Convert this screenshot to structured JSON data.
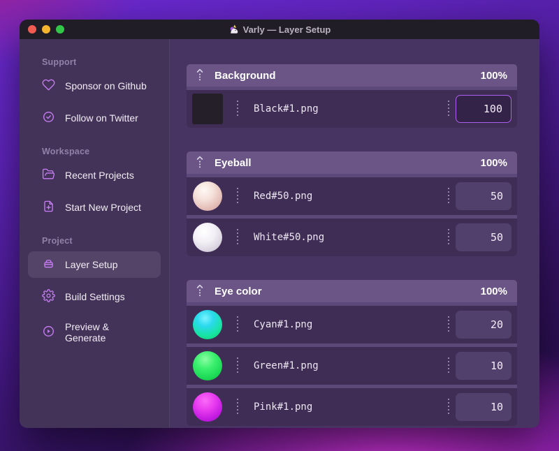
{
  "titlebar": {
    "title": "Varly — Layer Setup",
    "icon": "unicorn-icon",
    "traffic_lights": [
      {
        "name": "close-button",
        "color": "#f15b51"
      },
      {
        "name": "minimize-button",
        "color": "#f3b52e"
      },
      {
        "name": "zoom-button",
        "color": "#32c748"
      }
    ]
  },
  "sidebar": {
    "sections": [
      {
        "label": "Support",
        "items": [
          {
            "label": "Sponsor on Github",
            "icon": "heart-icon",
            "selected": false
          },
          {
            "label": "Follow on Twitter",
            "icon": "badge-check-icon",
            "selected": false
          }
        ]
      },
      {
        "label": "Workspace",
        "items": [
          {
            "label": "Recent Projects",
            "icon": "folder-open-icon",
            "selected": false
          },
          {
            "label": "Start New Project",
            "icon": "file-plus-icon",
            "selected": false
          }
        ]
      },
      {
        "label": "Project",
        "items": [
          {
            "label": "Layer Setup",
            "icon": "layer-box-icon",
            "selected": true
          },
          {
            "label": "Build Settings",
            "icon": "gear-icon",
            "selected": false
          },
          {
            "label": "Preview & Generate",
            "icon": "play-circle-icon",
            "selected": false
          }
        ]
      }
    ]
  },
  "main": {
    "groups": [
      {
        "name": "Background",
        "weight_label": "100%",
        "drag_icon": "drag-handle-icon",
        "rows": [
          {
            "file": "Black#1.png",
            "value": "100",
            "thumb": "black-square-thumb",
            "focused": true
          }
        ]
      },
      {
        "name": "Eyeball",
        "weight_label": "100%",
        "drag_icon": "drag-handle-icon",
        "rows": [
          {
            "file": "Red#50.png",
            "value": "50",
            "thumb": "red-sphere-thumb",
            "focused": false
          },
          {
            "file": "White#50.png",
            "value": "50",
            "thumb": "white-sphere-thumb",
            "focused": false
          }
        ]
      },
      {
        "name": "Eye color",
        "weight_label": "100%",
        "drag_icon": "drag-handle-icon",
        "rows": [
          {
            "file": "Cyan#1.png",
            "value": "20",
            "thumb": "cyan-sphere-thumb",
            "focused": false
          },
          {
            "file": "Green#1.png",
            "value": "10",
            "thumb": "green-sphere-thumb",
            "focused": false
          },
          {
            "file": "Pink#1.png",
            "value": "10",
            "thumb": "pink-sphere-thumb",
            "focused": false
          }
        ]
      }
    ]
  },
  "colors": {
    "accent": "#c77df5",
    "focus_border": "#ad5ff0",
    "sidebar_bg": "#443359",
    "main_bg": "#473462",
    "group_header_bg": "#6b5587",
    "row_bg": "#3f2d55",
    "titlebar_bg": "#211d26"
  }
}
